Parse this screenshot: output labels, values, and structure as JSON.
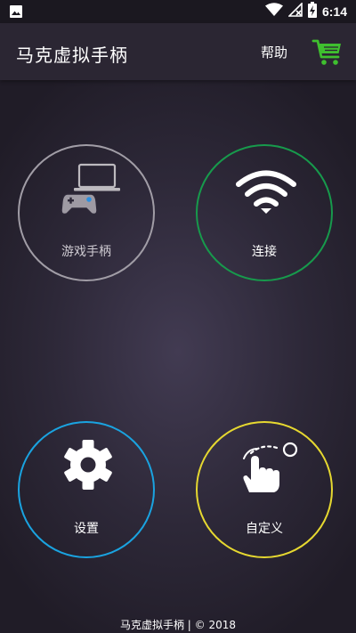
{
  "status_bar": {
    "time": "6:14",
    "icons": [
      "image-icon",
      "wifi-icon",
      "signal-off-icon",
      "battery-charging-icon"
    ]
  },
  "app_bar": {
    "title": "马克虚拟手柄",
    "help_label": "帮助",
    "cart_icon": "shopping-cart-icon",
    "cart_color": "#3fbf2f"
  },
  "tiles": [
    {
      "label": "游戏手柄",
      "icon": "laptop-gamepad-icon",
      "color": "#a19da6"
    },
    {
      "label": "连接",
      "icon": "wifi-icon",
      "color": "#179a4c"
    },
    {
      "label": "设置",
      "icon": "gear-icon",
      "color": "#1aa3e0"
    },
    {
      "label": "自定义",
      "icon": "hand-gesture-icon",
      "color": "#e6d830"
    }
  ],
  "footer": {
    "text": "马克虚拟手柄 | © 2018"
  }
}
